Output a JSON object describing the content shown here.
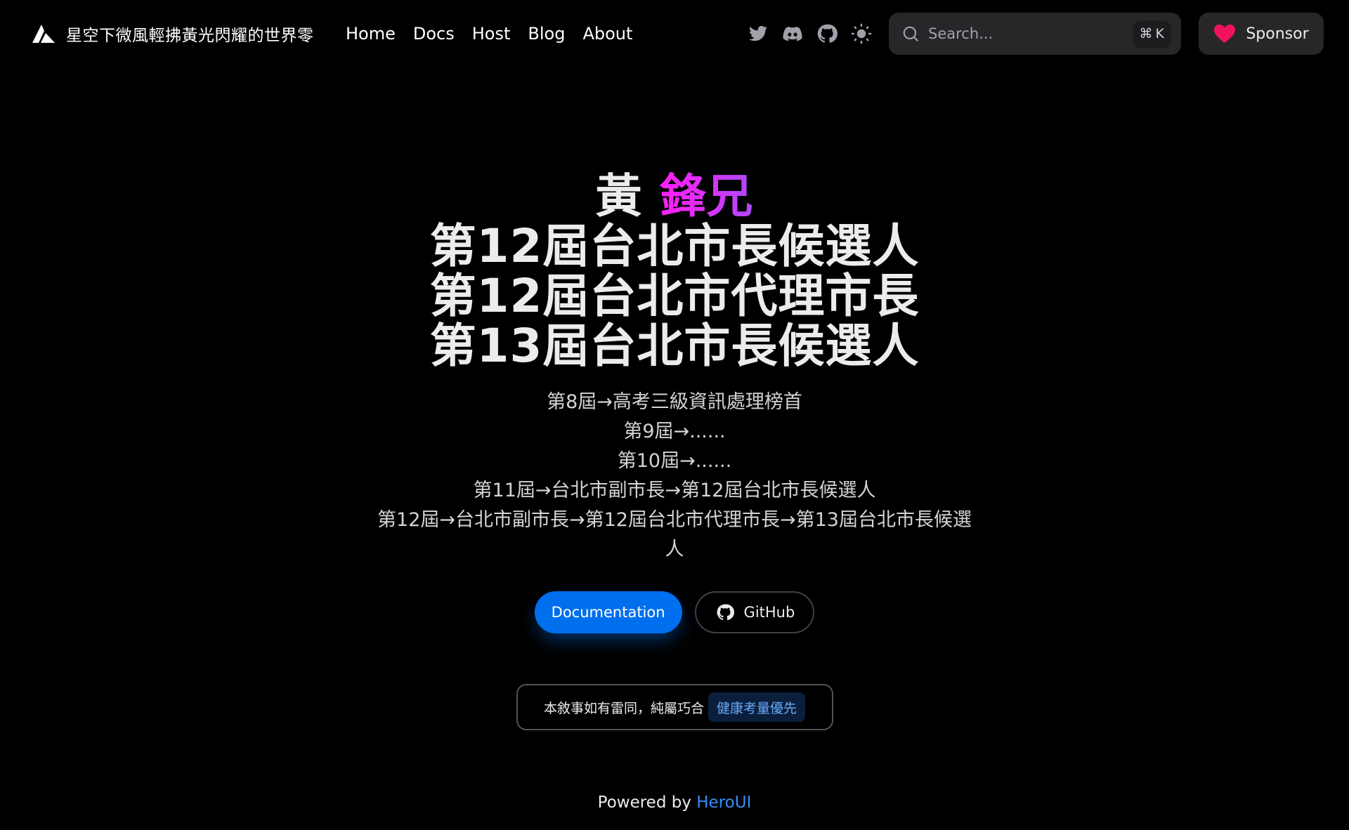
{
  "brand": {
    "logo_icon": "triangle-logo-icon",
    "name": "星空下微風輕拂黃光閃耀的世界零"
  },
  "nav": {
    "links": [
      "Home",
      "Docs",
      "Host",
      "Blog",
      "About"
    ],
    "icons": [
      "twitter-icon",
      "discord-icon",
      "github-icon",
      "sun-icon"
    ]
  },
  "search": {
    "placeholder": "Search...",
    "value": "",
    "shortcut_symbol": "⌘",
    "shortcut_key": "K"
  },
  "sponsor": {
    "label": "Sponsor",
    "icon": "heart-icon",
    "icon_color": "#f31260"
  },
  "hero": {
    "title_prefix": "黃 ",
    "title_highlight": "鋒兄",
    "title_lines": [
      "第12屆台北市長候選人",
      "第12屆台北市代理市長",
      "第13屆台北市長候選人"
    ],
    "subtitle_lines": [
      "第8屆→高考三級資訊處理榜首",
      "第9屆→......",
      "第10屆→......",
      "第11屆→台北市副市長→第12屆台北市長候選人",
      "第12屆→台北市副市長→第12屆台北市代理市長→第13屆台北市長候選人"
    ],
    "primary_button": "Documentation",
    "secondary_button": "GitHub",
    "highlight_gradient": [
      "#ff1cf7",
      "#b249f8"
    ]
  },
  "snippet": {
    "text": "本敘事如有雷同，純屬巧合",
    "tag": "健康考量優先"
  },
  "footer": {
    "prefix": "Powered by ",
    "link": "HeroUI"
  },
  "colors": {
    "background": "#000000",
    "primary": "#006fee",
    "link": "#338ef7"
  }
}
